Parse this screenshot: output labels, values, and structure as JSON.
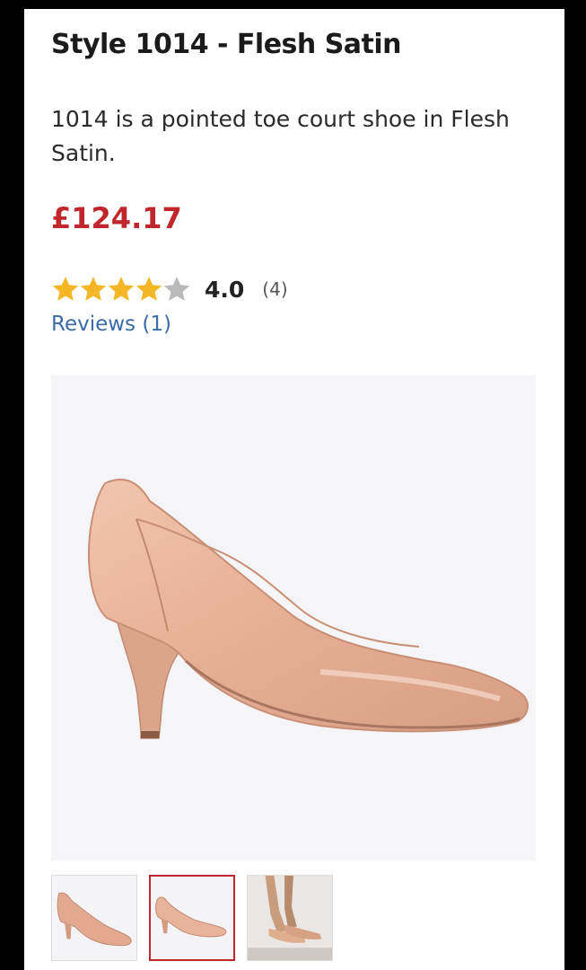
{
  "product": {
    "title": "Style 1014 - Flesh Satin",
    "description": "1014 is a pointed toe court shoe in Flesh Satin.",
    "price": "£124.17",
    "rating": {
      "stars": 4,
      "max_stars": 5,
      "value_label": "4.0",
      "count_label": "(4)"
    },
    "reviews_link": "Reviews (1)"
  },
  "gallery": {
    "selected_index": 1,
    "thumbnails": [
      {
        "name": "shoe-side-view-1"
      },
      {
        "name": "shoe-side-view-2"
      },
      {
        "name": "shoe-worn-on-feet"
      }
    ]
  },
  "colors": {
    "price": "#c0262b",
    "star_filled": "#f5b626",
    "star_empty": "#b9b9b9",
    "link": "#3b6aa8",
    "satin": "#e8b49c"
  }
}
